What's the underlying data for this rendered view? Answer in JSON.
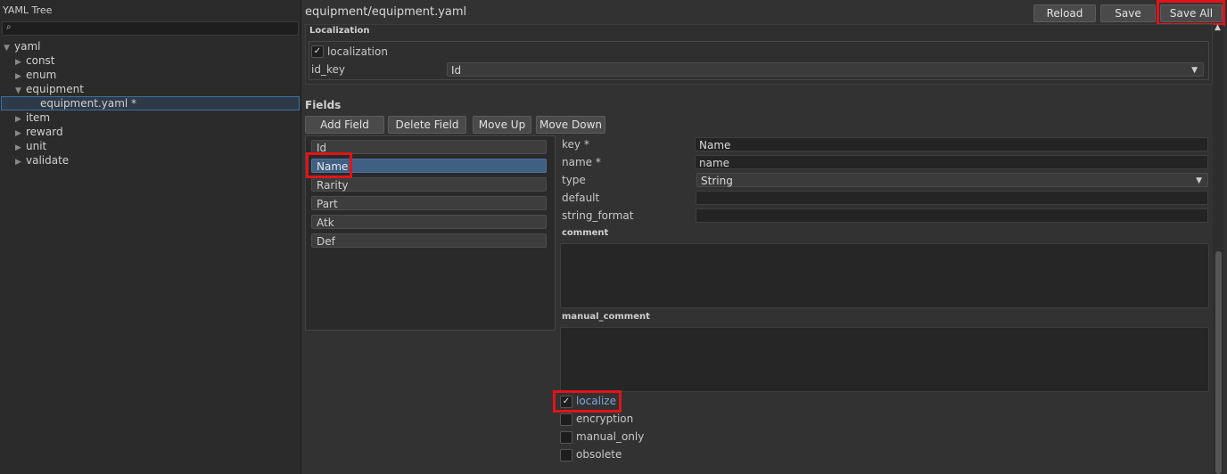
{
  "left_panel": {
    "title": "YAML Tree",
    "search": {
      "placeholder": "",
      "value": ""
    },
    "tree": [
      {
        "label": "yaml",
        "expanded": true,
        "depth": 0
      },
      {
        "label": "const",
        "expanded": false,
        "depth": 1
      },
      {
        "label": "enum",
        "expanded": false,
        "depth": 1
      },
      {
        "label": "equipment",
        "expanded": true,
        "depth": 1
      },
      {
        "label": "equipment.yaml *",
        "depth": 2,
        "selected": true
      },
      {
        "label": "item",
        "expanded": false,
        "depth": 1
      },
      {
        "label": "reward",
        "expanded": false,
        "depth": 1
      },
      {
        "label": "unit",
        "expanded": false,
        "depth": 1
      },
      {
        "label": "validate",
        "expanded": false,
        "depth": 1
      }
    ]
  },
  "editor": {
    "path_title": "equipment/equipment.yaml",
    "toolbar": {
      "reload": "Reload",
      "save": "Save",
      "save_all": "Save All"
    },
    "localization": {
      "group_title": "Localization",
      "checkbox_label": "localization",
      "checked": true,
      "id_key_label": "id_key",
      "id_key_value": "Id"
    },
    "fields": {
      "title": "Fields",
      "buttons": {
        "add": "Add Field",
        "delete": "Delete Field",
        "up": "Move Up",
        "down": "Move Down"
      },
      "items": [
        "Id",
        "Name",
        "Rarity",
        "Part",
        "Atk",
        "Def"
      ],
      "selected": "Name"
    },
    "detail": {
      "key_label": "key *",
      "key_value": "Name",
      "name_label": "name *",
      "name_value": "name",
      "type_label": "type",
      "type_value": "String",
      "default_label": "default",
      "default_value": "",
      "string_format_label": "string_format",
      "string_format_value": "",
      "comment_label": "comment",
      "comment_value": "",
      "manual_comment_label": "manual_comment",
      "manual_comment_value": "",
      "checkboxes": [
        {
          "label": "localize",
          "checked": true
        },
        {
          "label": "encryption",
          "checked": false
        },
        {
          "label": "manual_only",
          "checked": false
        },
        {
          "label": "obsolete",
          "checked": false
        }
      ]
    }
  },
  "colors": {
    "accent_selected": "#3f5f83",
    "highlight_box": "#e0141a",
    "background": "#323232"
  },
  "icons": {
    "check": "✓",
    "expand": "▼",
    "collapse": "▶",
    "dropdown": "▼",
    "search": "search-icon"
  }
}
